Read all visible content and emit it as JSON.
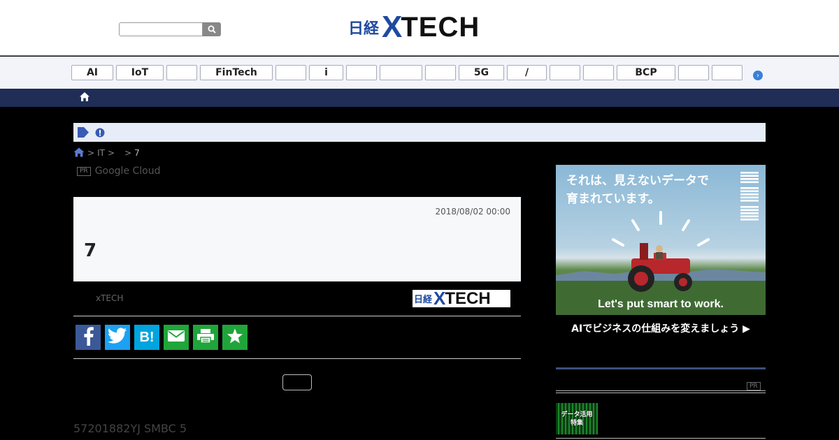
{
  "header": {
    "search": {
      "placeholder": "",
      "value": ""
    },
    "logo": {
      "nikkei": "日経",
      "x": "X",
      "tech": "TECH"
    }
  },
  "tags": [
    {
      "label": "AI"
    },
    {
      "label": "IoT"
    },
    {
      "label": ""
    },
    {
      "label": "FinTech"
    },
    {
      "label": ""
    },
    {
      "label": "i"
    },
    {
      "label": ""
    },
    {
      "label": ""
    },
    {
      "label": ""
    },
    {
      "label": "5G"
    },
    {
      "label": "/"
    },
    {
      "label": ""
    },
    {
      "label": ""
    },
    {
      "label": "BCP"
    },
    {
      "label": ""
    },
    {
      "label": ""
    }
  ],
  "breadcrumb": {
    "sep": ">",
    "it": "IT",
    "current": "7"
  },
  "pr_line": {
    "badge": "PR",
    "text": "Google Cloud"
  },
  "article": {
    "date": "2018/08/02 00:00",
    "title": "7",
    "byline": "xTECH"
  },
  "body_text": "57201882YJ SMBC 5",
  "ad": {
    "headline_line1": "それは、見えないデータで",
    "headline_line2": "育まれています。",
    "brand": "IBM",
    "tagline": "Let's put smart to work.",
    "cta": "AIでビジネスの仕組みを変えましょう ▶"
  },
  "sidebar": {
    "pr_badge": "PR",
    "thumb_line1": "データ活用",
    "thumb_line2": "特集"
  },
  "colors": {
    "brand_blue": "#1e4aa0",
    "nav_navy": "#1f2d57",
    "facebook": "#3b5998",
    "twitter": "#1da1f2",
    "hatena": "#00a4de",
    "mail": "#20a53a",
    "print": "#20a53a",
    "favorite": "#20a53a"
  }
}
